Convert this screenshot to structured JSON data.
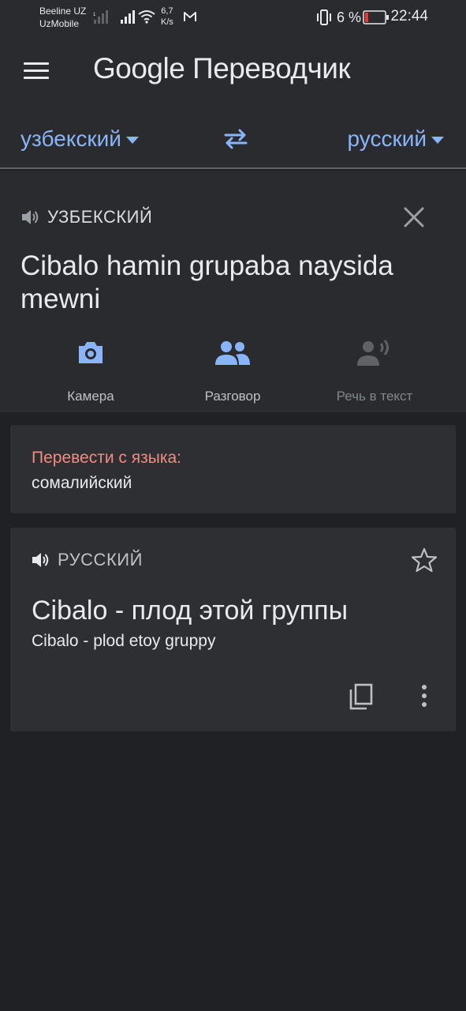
{
  "status_bar": {
    "carrier_1": "Beeline UZ",
    "carrier_2": "UzMobile",
    "speed_value": "6,7",
    "speed_unit": "K/s",
    "battery_percent": "6 %",
    "time": "22:44",
    "icons": [
      "signal-icon",
      "wifi-icon",
      "gmail-icon",
      "vibrate-icon",
      "battery-icon"
    ]
  },
  "app_bar": {
    "brand": "Google",
    "title": "Переводчик"
  },
  "language_bar": {
    "source": "узбекский",
    "target": "русский"
  },
  "input": {
    "language_header": "УЗБЕКСКИЙ",
    "text": "Cibalo hamin grupaba naysida mewni",
    "tools": [
      {
        "label": "Камера",
        "icon": "camera-icon"
      },
      {
        "label": "Разговор",
        "icon": "conversation-icon"
      },
      {
        "label": "Речь в текст",
        "icon": "speech-to-text-icon"
      }
    ]
  },
  "detect": {
    "hint": "Перевести с языка:",
    "language": "сомалийский"
  },
  "result": {
    "language_header": "РУССКИЙ",
    "text": "Cibalo - плод этой группы",
    "transliteration": "Cibalo - plod etoy gruppy"
  },
  "colors": {
    "accent": "#8ab4f8",
    "warning": "#f28b82",
    "background": "#202124",
    "surface": "#2a2b2e"
  }
}
